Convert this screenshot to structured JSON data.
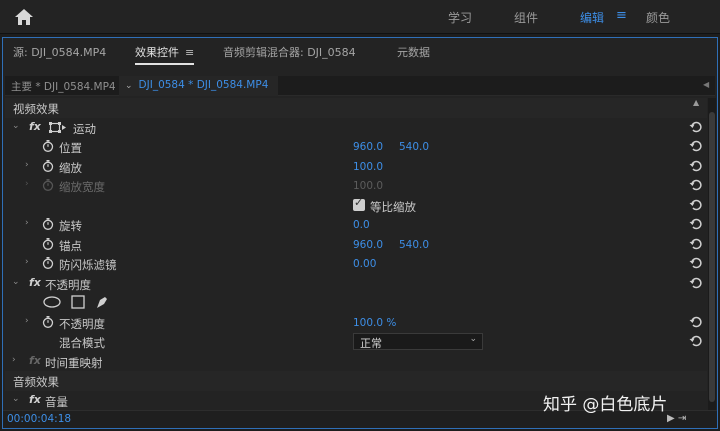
{
  "workspaces": {
    "tabs": [
      {
        "label": "学习",
        "active": false
      },
      {
        "label": "组件",
        "active": false
      },
      {
        "label": "编辑",
        "active": true
      },
      {
        "label": "颜色",
        "active": false
      }
    ]
  },
  "panel": {
    "tabs": [
      {
        "label": "源: DJI_0584.MP4",
        "active": false
      },
      {
        "label": "效果控件",
        "active": true
      },
      {
        "label": "音频剪辑混合器: DJI_0584",
        "active": false
      },
      {
        "label": "元数据",
        "active": false
      }
    ],
    "master_clip": "主要 * DJI_0584.MP4",
    "sequence_clip": "DJI_0584 * DJI_0584.MP4"
  },
  "effects": {
    "video_section": "视频效果",
    "motion": {
      "label": "运动",
      "position": {
        "label": "位置",
        "x": "960.0",
        "y": "540.0"
      },
      "scale": {
        "label": "缩放",
        "value": "100.0"
      },
      "scale_width": {
        "label": "缩放宽度",
        "value": "100.0"
      },
      "uniform_scale": {
        "label": "等比缩放",
        "checked": true
      },
      "rotation": {
        "label": "旋转",
        "value": "0.0"
      },
      "anchor": {
        "label": "锚点",
        "x": "960.0",
        "y": "540.0"
      },
      "anti_flicker": {
        "label": "防闪烁滤镜",
        "value": "0.00"
      }
    },
    "opacity": {
      "label": "不透明度",
      "value_label": "不透明度",
      "value": "100.0 %",
      "blend_label": "混合模式",
      "blend_value": "正常"
    },
    "time_remap": {
      "label": "时间重映射"
    },
    "audio_section": "音频效果",
    "volume": {
      "label": "音量"
    }
  },
  "footer": {
    "timecode": "00:00:04:18"
  },
  "watermark": "知乎 @白色底片",
  "colors": {
    "accent": "#3d8ee6",
    "panel_bg": "#232323",
    "focus_border": "#2f6fb7"
  }
}
